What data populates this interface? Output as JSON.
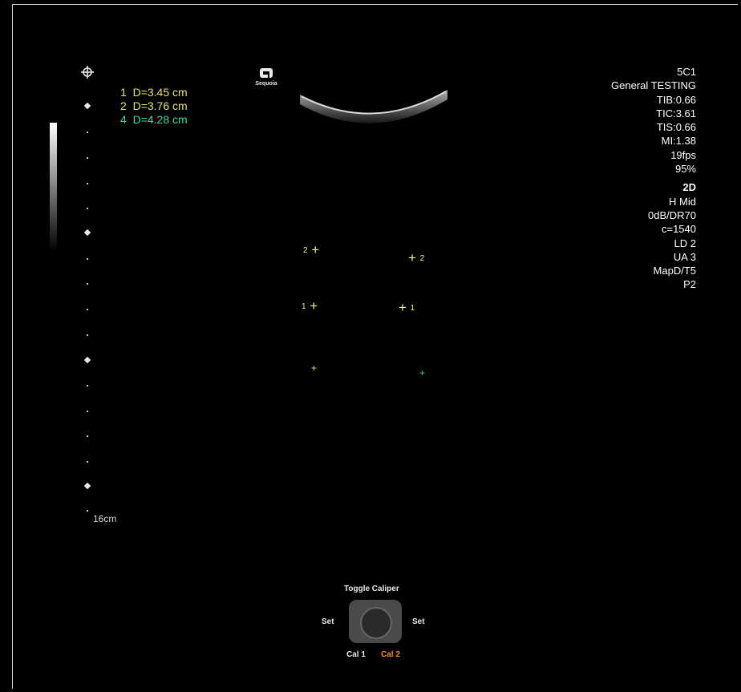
{
  "logo": {
    "brand": "Sequoia"
  },
  "measurements": [
    {
      "id": "1",
      "text": "D=3.45 cm",
      "color": "#e6e27a"
    },
    {
      "id": "2",
      "text": "D=3.76 cm",
      "color": "#e6e27a"
    },
    {
      "id": "4",
      "text": "D=4.28 cm",
      "color": "#3fd6a8"
    }
  ],
  "info": {
    "transducer": "5C1",
    "preset": "General TESTING",
    "tib": "TIB:0.66",
    "tic": "TIC:3.61",
    "tis": "TIS:0.66",
    "mi": "MI:1.38",
    "fps": "19fps",
    "power": "95%",
    "mode": "2D",
    "freq": "H Mid",
    "gain": "0dB/DR70",
    "speed": "c=1540",
    "ld": "LD 2",
    "ua": "UA 3",
    "map": "MapD/T5",
    "persist": "P2"
  },
  "depth_label": "16cm",
  "calipers": [
    {
      "label": "2",
      "side": "left"
    },
    {
      "label": "2",
      "side": "right"
    },
    {
      "label": "1",
      "side": "left"
    },
    {
      "label": "1",
      "side": "right"
    }
  ],
  "controls": {
    "title": "Toggle Caliper",
    "set_left": "Set",
    "set_right": "Set",
    "cal1": "Cal 1",
    "cal2": "Cal 2",
    "cal2_color": "#ff8a1e"
  },
  "icons": {
    "focus": "crosshair-icon"
  }
}
